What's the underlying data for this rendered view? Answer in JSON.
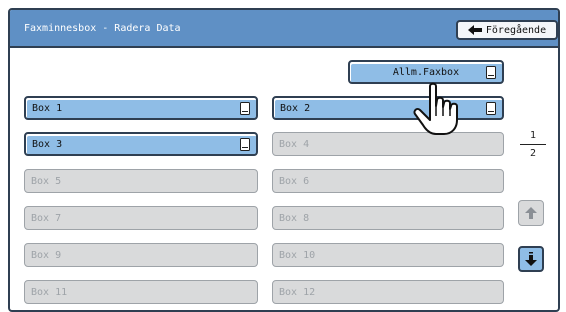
{
  "title": "Faxminnesbox - Radera Data",
  "back_label": "Föregående",
  "all_faxbox_label": "Allm.Faxbox",
  "boxes": [
    {
      "label": "Box 1",
      "active": true
    },
    {
      "label": "Box 2",
      "active": true
    },
    {
      "label": "Box 3",
      "active": true
    },
    {
      "label": "Box 4",
      "active": false
    },
    {
      "label": "Box 5",
      "active": false
    },
    {
      "label": "Box 6",
      "active": false
    },
    {
      "label": "Box 7",
      "active": false
    },
    {
      "label": "Box 8",
      "active": false
    },
    {
      "label": "Box 9",
      "active": false
    },
    {
      "label": "Box 10",
      "active": false
    },
    {
      "label": "Box 11",
      "active": false
    },
    {
      "label": "Box 12",
      "active": false
    }
  ],
  "pager": {
    "current": "1",
    "total": "2"
  },
  "icons": {
    "back": "arrow-left-icon",
    "document": "document-icon",
    "scroll_up": "arrow-up-icon",
    "scroll_down": "arrow-down-icon",
    "pointer": "hand-pointer-icon"
  },
  "colors": {
    "title_bar": "#5f90c5",
    "active_button": "#8fbde6",
    "inactive_button": "#d9dadb",
    "border": "#2f3f52"
  }
}
